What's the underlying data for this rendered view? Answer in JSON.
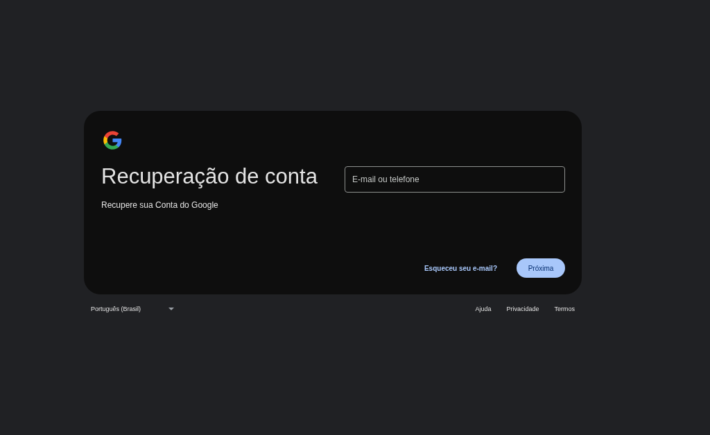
{
  "card": {
    "title": "Recuperação de conta",
    "subtitle": "Recupere sua Conta do Google",
    "field": {
      "placeholder": "E-mail ou telefone"
    },
    "link": "Esqueceu seu e-mail?",
    "button": "Próxima"
  },
  "footer": {
    "language": "Português (Brasil)",
    "links": [
      "Ajuda",
      "Privacidade",
      "Termos"
    ]
  }
}
